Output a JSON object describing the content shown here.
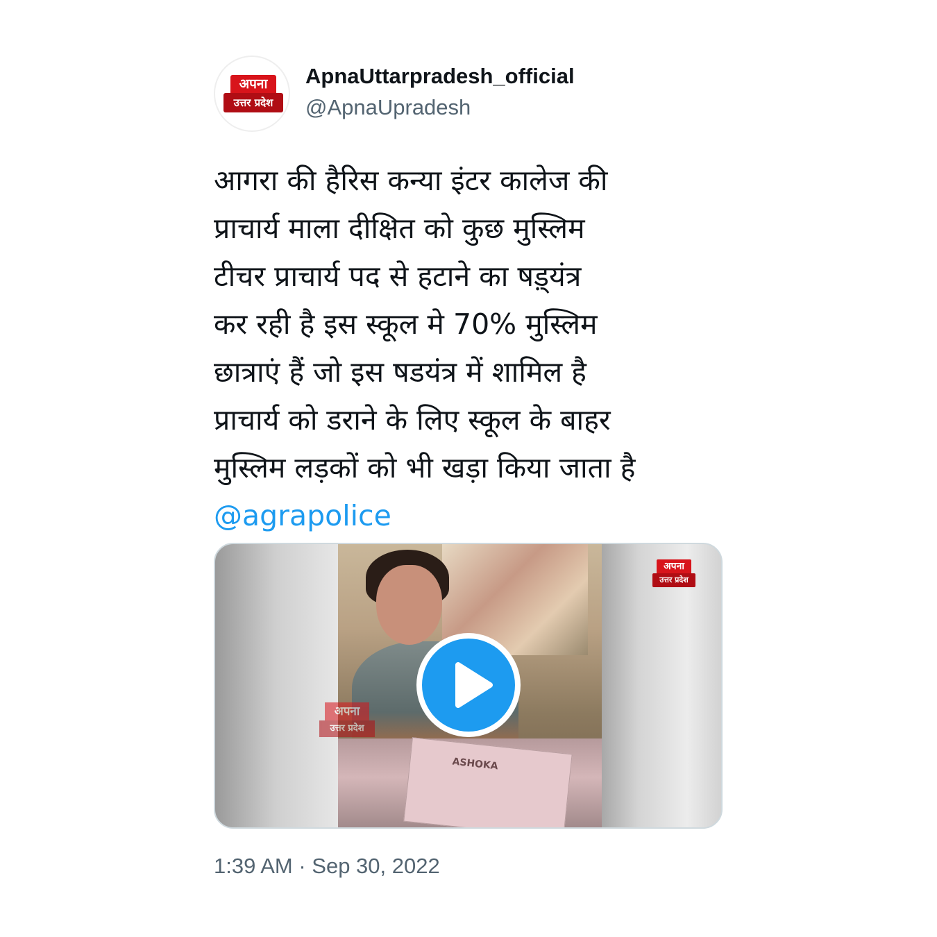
{
  "account": {
    "display_name": "ApnaUttarpradesh_official",
    "handle": "@ApnaUpradesh",
    "avatar_logo": {
      "top": "अपना",
      "bottom": "उत्तर प्रदेश"
    }
  },
  "tweet": {
    "lines": [
      "आगरा की हैरिस कन्या इंटर कालेज की",
      "प्राचार्य माला दीक्षित को कुछ मुस्लिम",
      "टीचर प्राचार्य पद से हटाने का षड़्यंत्र",
      "कर रही है इस स्कूल मे 70% मुस्लिम",
      "छात्राएं हैं जो इस षडयंत्र में शामिल है",
      "प्राचार्य को डराने के लिए स्कूल के बाहर",
      "मुस्लिम लड़कों को भी खड़ा किया जाता है"
    ],
    "mention": "@agrapolice",
    "timestamp": "1:39 AM · Sep 30, 2022"
  },
  "media": {
    "type": "video",
    "play_icon": "play-icon",
    "watermark": {
      "top": "अपना",
      "bottom": "उत्तर प्रदेश"
    },
    "file_label": "ASHOKA"
  },
  "colors": {
    "link": "#1d9bf0",
    "text": "#0f1419",
    "secondary": "#536471",
    "brand_red": "#d8141b"
  }
}
